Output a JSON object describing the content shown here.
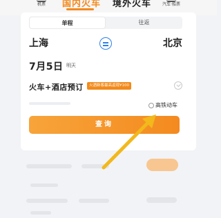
{
  "nav": {
    "left_label": "机票",
    "tab_domestic": "国内火车",
    "tab_overseas": "境外火车",
    "right_label": "汽车·船票"
  },
  "trip_type": {
    "oneway": "单程",
    "round": "往返"
  },
  "route": {
    "from": "上海",
    "to": "北京"
  },
  "date": {
    "value": "7月5日",
    "weekday": "明天"
  },
  "hotel": {
    "label": "火车+酒店预订",
    "promo": "火酒新客最高返现¥100"
  },
  "options": {
    "hsr_label": "高铁动车"
  },
  "query_label": "查询",
  "colors": {
    "accent": "#f5891c",
    "swap_blue": "#2e7fea",
    "annotation_arrow": "#f2b81c"
  }
}
